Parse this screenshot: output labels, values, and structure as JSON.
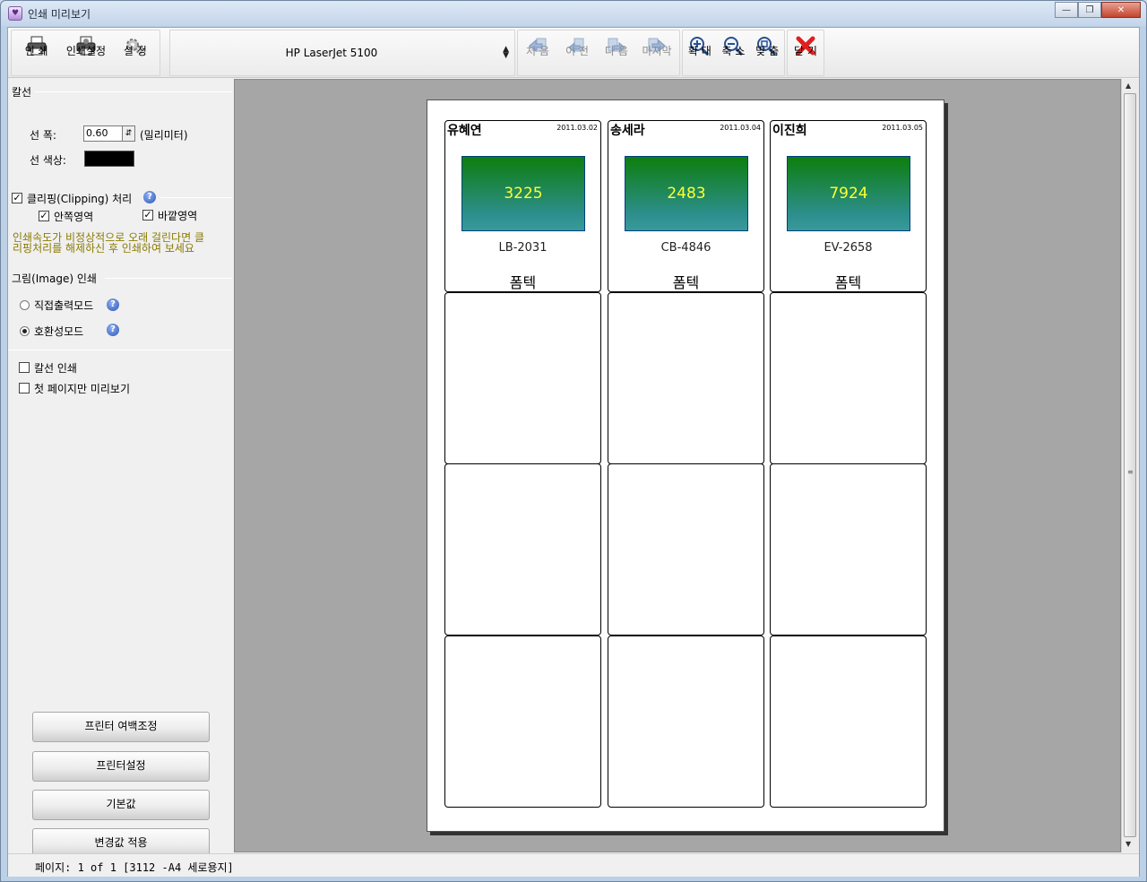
{
  "window": {
    "title": "인쇄 미리보기",
    "icon": "printer-app-icon"
  },
  "toolbar": {
    "print_label": "인 쇄",
    "print_setup_label": "인쇄설정",
    "settings_label": "설 정",
    "printer_selected": "HP LaserJet 5100",
    "first_label": "처 음",
    "prev_label": "이 전",
    "next_label": "다 음",
    "last_label": "마지막",
    "zoom_in_label": "확 대",
    "zoom_out_label": "축 소",
    "fit_label": "맞 춤",
    "close_label": "닫 기"
  },
  "panel": {
    "ruled_section": "칼선",
    "line_width_label": "선 폭:",
    "line_width_value": "0.60",
    "line_width_unit": "(밀리미터)",
    "line_color_label": "선 색상:",
    "line_color": "#000000",
    "clipping_label": "클리핑(Clipping) 처리",
    "clipping_checked": true,
    "inner_label": "안쪽영역",
    "inner_checked": true,
    "outer_label": "바깥영역",
    "outer_checked": true,
    "warning_line1": "인쇄속도가 비정상적으로 오래 걸린다면 클",
    "warning_line2": "리핑처리를 해제하신 후 인쇄하여 보세요",
    "image_section": "그림(Image) 인쇄",
    "direct_mode_label": "직접출력모드",
    "compat_mode_label": "호환성모드",
    "selected_mode": "호환성모드",
    "print_lines_label": "칼선 인쇄",
    "print_lines_checked": false,
    "first_page_only_label": "첫 페이지만 미리보기",
    "first_page_only_checked": false,
    "btn_margin": "프린터 여백조정",
    "btn_printer_setup": "프린터설정",
    "btn_default": "기본값",
    "btn_apply": "변경값 적용"
  },
  "labels": [
    {
      "name": "유혜연",
      "date": "2011.03.02",
      "number": "3225",
      "code": "LB-2031",
      "company": "폼텍"
    },
    {
      "name": "송세라",
      "date": "2011.03.04",
      "number": "2483",
      "code": "CB-4846",
      "company": "폼텍"
    },
    {
      "name": "이진희",
      "date": "2011.03.05",
      "number": "7924",
      "code": "EV-2658",
      "company": "폼텍"
    }
  ],
  "status": {
    "text": "페이지: 1 of 1 [3112 -A4 세로용지]"
  }
}
